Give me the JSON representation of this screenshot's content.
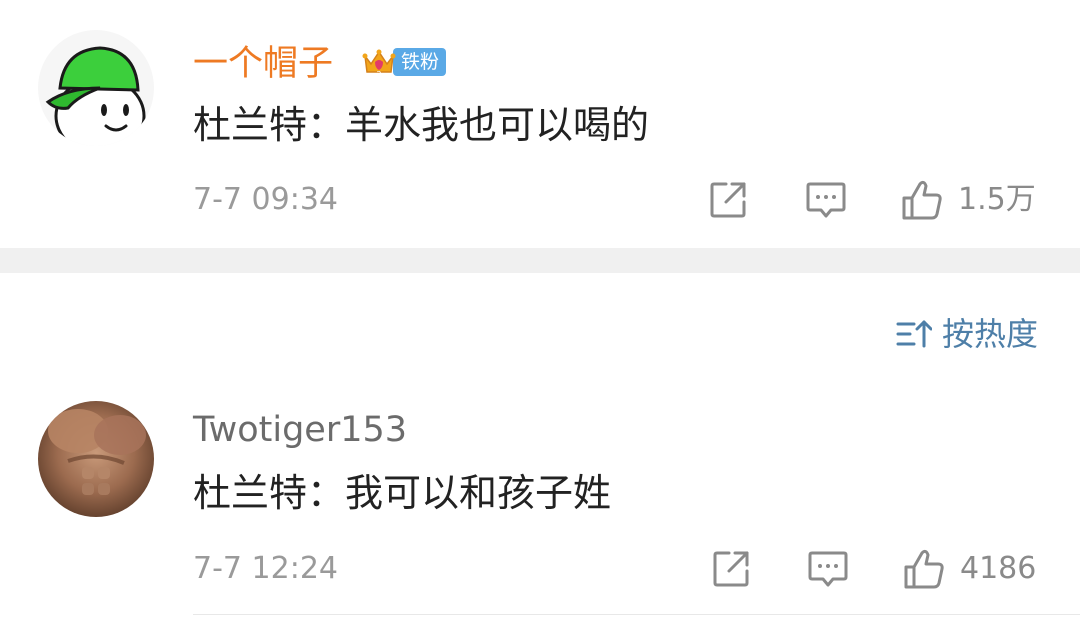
{
  "comments": [
    {
      "username": "一个帽子",
      "username_color": "#ee7a23",
      "badge": {
        "label": "铁粉",
        "icon": "crown-level-2-icon",
        "color": "#5aa9e6"
      },
      "text": "杜兰特：羊水我也可以喝的",
      "timestamp": "7-7 09:34",
      "likes": "1.5万",
      "avatar": "green-cap-cartoon-avatar"
    },
    {
      "username": "Twotiger153",
      "username_color": "#6b6b6b",
      "text": "杜兰特：我可以和孩子姓",
      "timestamp": "7-7 12:24",
      "likes": "4186",
      "avatar": "muscle-photo-avatar"
    }
  ],
  "sort": {
    "label": "按热度",
    "icon": "sort-icon",
    "color": "#4e7fa8"
  },
  "icons": {
    "share": "share-icon",
    "reply": "comment-icon",
    "like": "thumbs-up-icon"
  }
}
